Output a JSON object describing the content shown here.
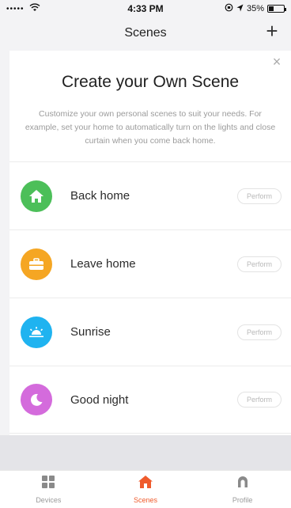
{
  "status_bar": {
    "signal": "•••••",
    "time": "4:33 PM",
    "battery_text": "35%",
    "battery_level": 0.35
  },
  "nav": {
    "title": "Scenes",
    "add_label": "+"
  },
  "card": {
    "close_label": "×",
    "heading": "Create your Own Scene",
    "description": "Customize your own personal scenes to suit your needs. For example, set your home to automatically turn on the lights and close curtain when you come back home."
  },
  "scenes": [
    {
      "label": "Back home",
      "action": "Perform",
      "icon": "home-icon",
      "color": "#4cbf59"
    },
    {
      "label": "Leave home",
      "action": "Perform",
      "icon": "briefcase-icon",
      "color": "#f5a623"
    },
    {
      "label": "Sunrise",
      "action": "Perform",
      "icon": "sunrise-icon",
      "color": "#1fb3f0"
    },
    {
      "label": "Good night",
      "action": "Perform",
      "icon": "moon-icon",
      "color": "#d46bdc"
    }
  ],
  "tabs": [
    {
      "label": "Devices",
      "icon": "grid-icon",
      "active": false
    },
    {
      "label": "Scenes",
      "icon": "home-icon",
      "active": true
    },
    {
      "label": "Profile",
      "icon": "profile-icon",
      "active": false
    }
  ],
  "colors": {
    "accent": "#ef5b2c",
    "inactive_tab": "#9a9a9a"
  }
}
